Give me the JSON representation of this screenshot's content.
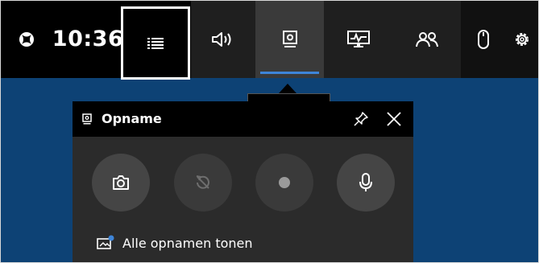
{
  "topbar": {
    "time": "10:36",
    "items": [
      {
        "name": "xbox",
        "icon": "xbox-logo-icon"
      },
      {
        "name": "widgets",
        "icon": "widget-menu-icon"
      },
      {
        "name": "audio",
        "icon": "speaker-icon"
      },
      {
        "name": "capture",
        "icon": "capture-icon"
      },
      {
        "name": "performance",
        "icon": "performance-monitor-icon"
      },
      {
        "name": "social",
        "icon": "people-icon"
      },
      {
        "name": "mouse",
        "icon": "mouse-icon"
      },
      {
        "name": "settings",
        "icon": "gear-icon"
      }
    ],
    "accent": "#3e85d8"
  },
  "tooltip": {
    "text": "Opname"
  },
  "widget": {
    "title": "Opname",
    "buttons": [
      {
        "name": "screenshot",
        "icon": "camera-icon",
        "enabled": true
      },
      {
        "name": "record-last",
        "icon": "record-last-icon",
        "enabled": false
      },
      {
        "name": "record",
        "icon": "record-dot-icon",
        "enabled": false
      },
      {
        "name": "microphone",
        "icon": "microphone-icon",
        "enabled": true
      }
    ],
    "show_all_label": "Alle opnamen tonen"
  },
  "colors": {
    "background": "#0d4275",
    "bar": "#000000",
    "panel": "#2b2b2b"
  }
}
